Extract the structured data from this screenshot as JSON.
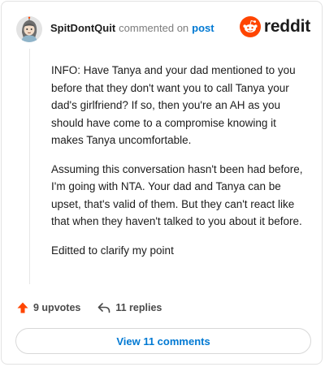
{
  "header": {
    "username": "SpitDontQuit",
    "action": "commented on",
    "link": "post"
  },
  "brand": {
    "name": "reddit",
    "color": "#ff4500"
  },
  "comment": {
    "paragraphs": [
      "INFO: Have Tanya and your dad mentioned to you before that they don't want you to call Tanya your dad's girlfriend? If so, then you're an AH as you should have come to a compromise knowing it makes Tanya uncomfortable.",
      "Assuming this conversation hasn't been had before, I'm going with NTA. Your dad and Tanya can be upset, that's valid of them. But they can't react like that when they haven't talked to you about it before.",
      "Editted to clarify my point"
    ]
  },
  "actions": {
    "upvotes": "9 upvotes",
    "replies": "11 replies"
  },
  "footer": {
    "view_comments": "View 11 comments"
  },
  "colors": {
    "accent": "#0079d3",
    "upvote": "#ff4500"
  },
  "icons": {
    "avatar": "avatar-icon",
    "brand": "reddit-logo-icon",
    "upvote": "upvote-arrow-icon",
    "reply": "reply-arrow-icon"
  }
}
